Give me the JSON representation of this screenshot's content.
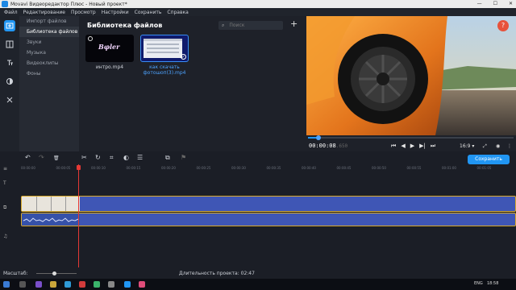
{
  "window": {
    "title": "Movavi Видеоредактор Плюс - Новый проект*",
    "minimize": "—",
    "maximize": "☐",
    "close": "✕"
  },
  "menu": [
    "Файл",
    "Редактирование",
    "Просмотр",
    "Настройки",
    "Сохранить",
    "Справка"
  ],
  "left_tools": [
    "import-icon",
    "transitions-icon",
    "titles-icon",
    "filters-icon",
    "more-tools-icon"
  ],
  "sidebar": {
    "items": [
      "Импорт файлов",
      "Библиотека файлов",
      "Звуки",
      "Музыка",
      "Видеоклипы",
      "Фоны"
    ],
    "selected_index": 1
  },
  "library": {
    "title": "Библиотека файлов",
    "search_placeholder": "Поиск",
    "add_label": "+",
    "files": [
      {
        "name": "интро.mp4",
        "thumb_text": "Bφler"
      },
      {
        "name": "как скачать фотошоп(3).mp4",
        "selected": true
      }
    ]
  },
  "player": {
    "timecode": "00:00:08",
    "timecode_ms": ".650",
    "progress_fraction": 0.05,
    "controls": [
      "⏮",
      "◀",
      "▶",
      "▶|",
      "⏭"
    ],
    "ratio": "16:9 ▾",
    "help_label": "?"
  },
  "toolbar": {
    "undo": "↶",
    "redo": "↷",
    "delete": "🗑",
    "cut": "✂",
    "rotate": "↻",
    "crop": "⌗",
    "color": "◐",
    "properties": "☰",
    "media": "⧉",
    "flag": "⚑",
    "save_label": "Сохранить"
  },
  "ruler": [
    "00:00:00",
    "00:00:05",
    "00:00:10",
    "00:00:15",
    "00:00:20",
    "00:00:25",
    "00:00:30",
    "00:00:35",
    "00:00:40",
    "00:00:45",
    "00:00:50",
    "00:00:55",
    "00:01:00",
    "00:01:05"
  ],
  "timeline": {
    "scale_label": "Масштаб:",
    "duration_label": "Длительность проекта: 02:47"
  },
  "taskbar": {
    "lang": "ENG",
    "time": "18:58"
  },
  "colors": {
    "accent": "#2196f3",
    "clip": "#3f56b5",
    "clip_border": "#d8a92c",
    "playhead": "#e53935",
    "help": "#e7523b"
  }
}
